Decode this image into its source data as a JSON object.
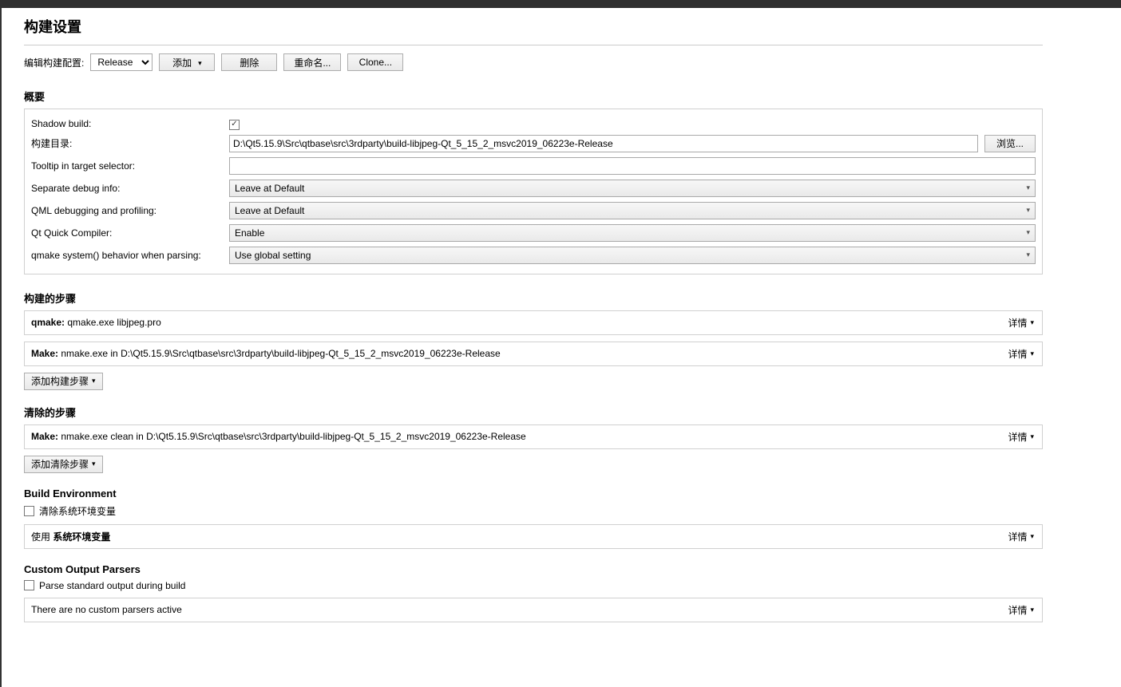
{
  "page": {
    "title": "构建设置"
  },
  "toolbar": {
    "edit_label": "编辑构建配置:",
    "config_selected": "Release",
    "add_label": "添加",
    "delete_label": "删除",
    "rename_label": "重命名...",
    "clone_label": "Clone..."
  },
  "overview": {
    "title": "概要",
    "shadow_build_label": "Shadow build:",
    "shadow_build_checked": true,
    "build_dir_label": "构建目录:",
    "build_dir_value": "D:\\Qt5.15.9\\Src\\qtbase\\src\\3rdparty\\build-libjpeg-Qt_5_15_2_msvc2019_06223e-Release",
    "browse_label": "浏览...",
    "tooltip_label": "Tooltip in target selector:",
    "tooltip_value": "",
    "separate_debug_label": "Separate debug info:",
    "separate_debug_value": "Leave at Default",
    "qml_debug_label": "QML debugging and profiling:",
    "qml_debug_value": "Leave at Default",
    "qt_quick_compiler_label": "Qt Quick Compiler:",
    "qt_quick_compiler_value": "Enable",
    "qmake_system_label": "qmake system() behavior when parsing:",
    "qmake_system_value": "Use global setting"
  },
  "build_steps": {
    "title": "构建的步骤",
    "details_label": "详情",
    "add_label": "添加构建步骤",
    "steps": [
      {
        "name": "qmake:",
        "cmd": "qmake.exe libjpeg.pro"
      },
      {
        "name": "Make:",
        "cmd": "nmake.exe in D:\\Qt5.15.9\\Src\\qtbase\\src\\3rdparty\\build-libjpeg-Qt_5_15_2_msvc2019_06223e-Release"
      }
    ]
  },
  "clean_steps": {
    "title": "清除的步骤",
    "details_label": "详情",
    "add_label": "添加清除步骤",
    "steps": [
      {
        "name": "Make:",
        "cmd": "nmake.exe clean in D:\\Qt5.15.9\\Src\\qtbase\\src\\3rdparty\\build-libjpeg-Qt_5_15_2_msvc2019_06223e-Release"
      }
    ]
  },
  "build_env": {
    "title": "Build Environment",
    "clear_label": "清除系统环境变量",
    "clear_checked": false,
    "use_prefix": "使用 ",
    "use_bold": "系统环境变量",
    "details_label": "详情"
  },
  "parsers": {
    "title": "Custom Output Parsers",
    "parse_stdout_label": "Parse standard output during build",
    "parse_stdout_checked": false,
    "status": "There are no custom parsers active",
    "details_label": "详情"
  }
}
